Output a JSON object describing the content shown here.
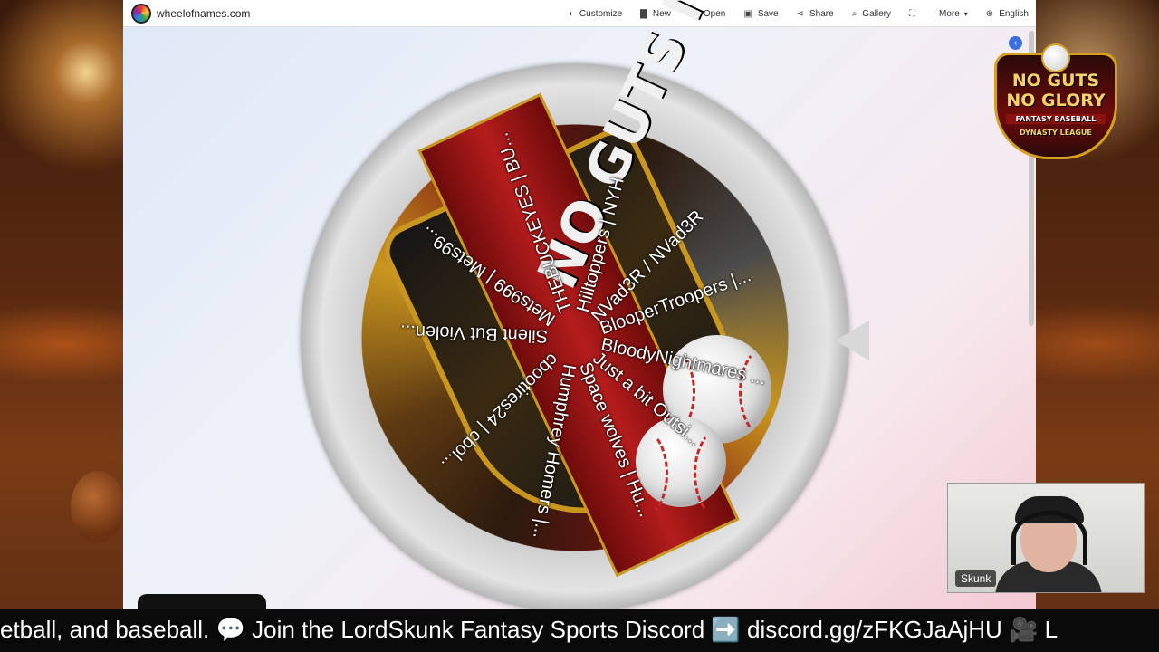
{
  "browser": {
    "site": "wheelofnames.com",
    "menu": [
      {
        "label": "Customize",
        "icon": "palette-icon",
        "glyph": "◐"
      },
      {
        "label": "New",
        "icon": "document-icon",
        "glyph": "▇"
      },
      {
        "label": "Open",
        "icon": "folder-icon",
        "glyph": "▬"
      },
      {
        "label": "Save",
        "icon": "save-icon",
        "glyph": "▣"
      },
      {
        "label": "Share",
        "icon": "share-icon",
        "glyph": "⋖"
      },
      {
        "label": "Gallery",
        "icon": "search-icon",
        "glyph": "⌕"
      },
      {
        "label": "",
        "icon": "fullscreen-icon",
        "glyph": "⛶"
      },
      {
        "label": "More",
        "icon": "chevron-down-icon",
        "glyph": "▾"
      },
      {
        "label": "English",
        "icon": "globe-icon",
        "glyph": "⊕"
      }
    ]
  },
  "wheel": {
    "center_text": "NO GUTS NO GLORY",
    "entries": [
      "Hilltoppers | NYH",
      "NVad3R / NVad3R",
      "BlooperTroopers |...",
      "BloodyNightmares ...",
      "Just a bit Outsi...",
      "Space wolves | Hu...",
      "Humphrey Homers |...",
      "cbootires24 | cbol...",
      "Silent But Violen...",
      "Mets999 | Mets99...",
      "THEBUCKEYES | BU..."
    ]
  },
  "league_logo": {
    "line1": "NO GUTS",
    "line2": "NO GLORY",
    "line3": "FANTASY BASEBALL",
    "line4": "DYNASTY LEAGUE"
  },
  "webcam": {
    "name": "Skunk"
  },
  "ticker": {
    "part1": "etball, and baseball.",
    "icon1": "💬",
    "part2": "Join the LordSkunk Fantasy Sports Discord",
    "icon2": "➡️",
    "part3": "discord.gg/zFKGJaAjHU",
    "icon3": "🎥",
    "part4": "L"
  }
}
